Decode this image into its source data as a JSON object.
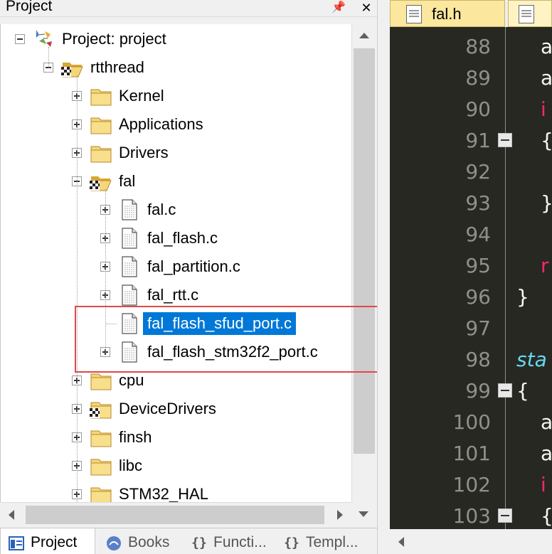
{
  "panel": {
    "title": "Project",
    "pin_glyph": "📌",
    "close_glyph": "✕"
  },
  "tree": [
    {
      "label": "Project: project",
      "level": 0,
      "icon": "project-icon",
      "expander": "minus"
    },
    {
      "label": "rtthread",
      "level": 1,
      "icon": "open-folder-icon",
      "expander": "minus"
    },
    {
      "label": "Kernel",
      "level": 2,
      "icon": "folder-icon",
      "expander": "plus"
    },
    {
      "label": "Applications",
      "level": 2,
      "icon": "folder-icon",
      "expander": "plus"
    },
    {
      "label": "Drivers",
      "level": 2,
      "icon": "folder-icon",
      "expander": "plus"
    },
    {
      "label": "fal",
      "level": 2,
      "icon": "open-folder-icon",
      "expander": "minus"
    },
    {
      "label": "fal.c",
      "level": 3,
      "icon": "file-icon",
      "expander": "plus"
    },
    {
      "label": "fal_flash.c",
      "level": 3,
      "icon": "file-icon",
      "expander": "plus"
    },
    {
      "label": "fal_partition.c",
      "level": 3,
      "icon": "file-icon",
      "expander": "plus"
    },
    {
      "label": "fal_rtt.c",
      "level": 3,
      "icon": "file-icon",
      "expander": "plus"
    },
    {
      "label": "fal_flash_sfud_port.c",
      "level": 3,
      "icon": "file-icon",
      "expander": "none",
      "selected": true
    },
    {
      "label": "fal_flash_stm32f2_port.c",
      "level": 3,
      "icon": "file-icon",
      "expander": "plus"
    },
    {
      "label": "cpu",
      "level": 2,
      "icon": "folder-icon",
      "expander": "plus"
    },
    {
      "label": "DeviceDrivers",
      "level": 2,
      "icon": "special-folder-icon",
      "expander": "plus"
    },
    {
      "label": "finsh",
      "level": 2,
      "icon": "folder-icon",
      "expander": "plus"
    },
    {
      "label": "libc",
      "level": 2,
      "icon": "folder-icon",
      "expander": "plus"
    },
    {
      "label": "STM32_HAL",
      "level": 2,
      "icon": "folder-icon",
      "expander": "plus"
    }
  ],
  "bottom_tabs": [
    {
      "label": "Project",
      "icon": "project-tab-icon",
      "active": true
    },
    {
      "label": "Books",
      "icon": "books-icon",
      "active": false
    },
    {
      "label": "Functi...",
      "icon": "{}",
      "active": false
    },
    {
      "label": "Templ...",
      "icon": "{}",
      "active": false
    }
  ],
  "editor": {
    "tabs": [
      {
        "label": "fal.h",
        "active": true
      },
      {
        "label": "",
        "active": false
      }
    ],
    "lines": [
      {
        "num": "88",
        "text": "a",
        "color": "#f8f8f2",
        "indent": 1,
        "fold": false
      },
      {
        "num": "89",
        "text": "a",
        "color": "#f8f8f2",
        "indent": 1,
        "fold": false
      },
      {
        "num": "90",
        "text": "i",
        "color": "#f92672",
        "indent": 1,
        "fold": false
      },
      {
        "num": "91",
        "text": "{",
        "color": "#f8f8f2",
        "indent": 1,
        "fold": true
      },
      {
        "num": "92",
        "text": "",
        "color": "#f8f8f2",
        "indent": 1,
        "fold": false
      },
      {
        "num": "93",
        "text": "}",
        "color": "#f8f8f2",
        "indent": 1,
        "fold": false
      },
      {
        "num": "94",
        "text": "",
        "color": "#f8f8f2",
        "indent": 1,
        "fold": false
      },
      {
        "num": "95",
        "text": "r",
        "color": "#f92672",
        "indent": 1,
        "fold": false
      },
      {
        "num": "96",
        "text": "}",
        "color": "#f8f8f2",
        "indent": 0,
        "fold": false
      },
      {
        "num": "97",
        "text": "",
        "color": "#f8f8f2",
        "indent": 0,
        "fold": false
      },
      {
        "num": "98",
        "text": "sta",
        "color": "#66d9ef",
        "indent": 0,
        "fold": false,
        "italic": true
      },
      {
        "num": "99",
        "text": "{",
        "color": "#f8f8f2",
        "indent": 0,
        "fold": true
      },
      {
        "num": "100",
        "text": "a",
        "color": "#f8f8f2",
        "indent": 1,
        "fold": false
      },
      {
        "num": "101",
        "text": "a",
        "color": "#f8f8f2",
        "indent": 1,
        "fold": false
      },
      {
        "num": "102",
        "text": "i",
        "color": "#f92672",
        "indent": 1,
        "fold": false
      },
      {
        "num": "103",
        "text": "{",
        "color": "#f8f8f2",
        "indent": 1,
        "fold": true
      }
    ]
  },
  "colors": {
    "selection": "#0078d7",
    "highlight_box": "#e04848",
    "editor_bg": "#272822",
    "active_tab": "#fbe79d"
  }
}
